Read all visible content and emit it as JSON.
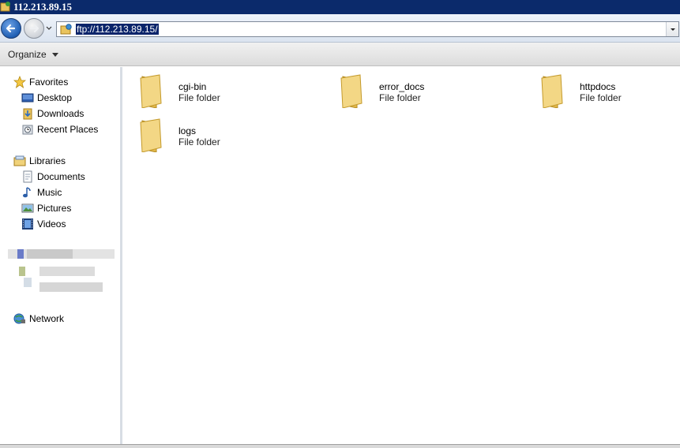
{
  "window": {
    "title": "112.213.89.15"
  },
  "address_bar": {
    "value": "ftp://112.213.89.15/"
  },
  "command_bar": {
    "organize_label": "Organize"
  },
  "sidebar": {
    "favorites": {
      "label": "Favorites",
      "items": [
        {
          "label": "Desktop",
          "icon": "desktop-icon"
        },
        {
          "label": "Downloads",
          "icon": "downloads-icon"
        },
        {
          "label": "Recent Places",
          "icon": "recent-places-icon"
        }
      ]
    },
    "libraries": {
      "label": "Libraries",
      "items": [
        {
          "label": "Documents",
          "icon": "documents-icon"
        },
        {
          "label": "Music",
          "icon": "music-icon"
        },
        {
          "label": "Pictures",
          "icon": "pictures-icon"
        },
        {
          "label": "Videos",
          "icon": "videos-icon"
        }
      ]
    },
    "network": {
      "label": "Network"
    }
  },
  "content": {
    "items": [
      {
        "name": "cgi-bin",
        "type": "File folder"
      },
      {
        "name": "error_docs",
        "type": "File folder"
      },
      {
        "name": "httpdocs",
        "type": "File folder"
      },
      {
        "name": "logs",
        "type": "File folder"
      }
    ]
  },
  "colors": {
    "title_bar": "#0b2a6b",
    "selection": "#0a246a",
    "folder": "#f3d785"
  }
}
